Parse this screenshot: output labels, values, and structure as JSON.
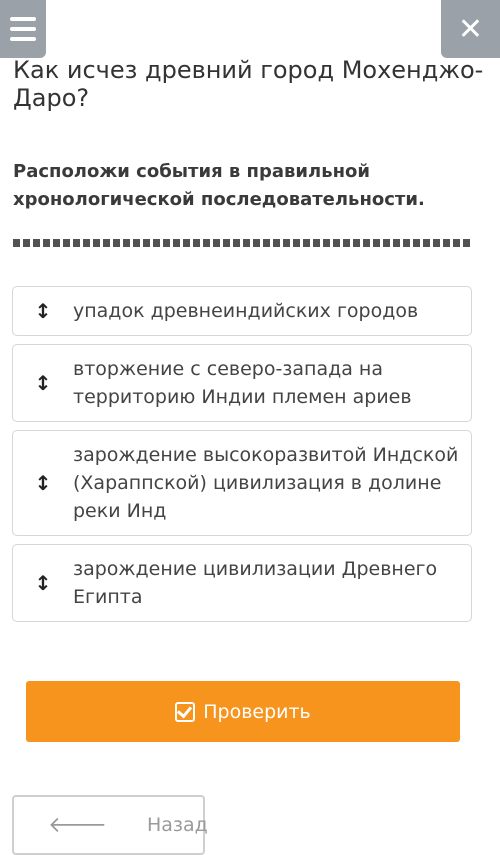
{
  "header": {
    "menu_icon": "hamburger-menu-icon",
    "close_icon": "close-icon",
    "close_glyph": "✕"
  },
  "question": {
    "title": "Как исчез древний город Мохенджо-Даро?",
    "instruction": "Расположи события в правильной хронологической последовательности."
  },
  "items": [
    {
      "handle": "↕",
      "text": "упадок древнеиндийских городов"
    },
    {
      "handle": "↕",
      "text": "вторжение с северо-запада на территорию Индии племен ариев"
    },
    {
      "handle": "↕",
      "text": "зарождение высокоразвитой Индской (Хараппской) цивилизация в долине реки Инд"
    },
    {
      "handle": "↕",
      "text": "зарождение цивилизации Древнего Египта"
    }
  ],
  "actions": {
    "check_label": "Проверить",
    "back_label": "Назад",
    "back_arrow": "🡐"
  },
  "colors": {
    "accent": "#f7941d",
    "header_buttons": "#9aa1a8"
  }
}
